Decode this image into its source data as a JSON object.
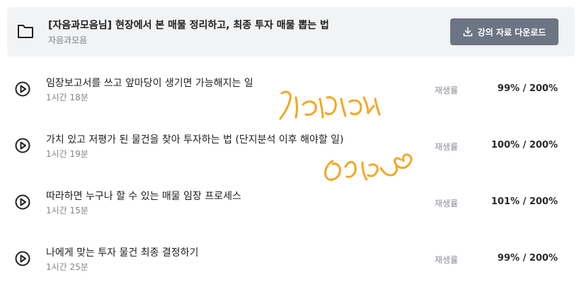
{
  "header": {
    "title": "[자음과모음님] 현장에서 본 매물 정리하고, 최종 투자 매물 뽑는 법",
    "subtitle": "자음과모음",
    "download_label": "강의 자료 다운로드",
    "folder_icon": "folder-icon",
    "download_icon": "download-icon"
  },
  "lessons": [
    {
      "title": "임장보고서를 쓰고 앞마당이 생기면 가능해지는 일",
      "duration": "1시간 18분",
      "rate_label": "재생률",
      "rate_value": "99% / 200%"
    },
    {
      "title": "가치 있고 저평가 된 물건을 찾아 투자하는 법 (단지분석 이후 해야할 일)",
      "duration": "1시간 19분",
      "rate_label": "재생률",
      "rate_value": "100% / 200%"
    },
    {
      "title": "따라하면 누구나 할 수 있는 매물 임장 프로세스",
      "duration": "1시간 15분",
      "rate_label": "재생률",
      "rate_value": "101% / 200%"
    },
    {
      "title": "나에게 맞는 투자 물건 최종 결정하기",
      "duration": "1시간 25분",
      "rate_label": "재생률",
      "rate_value": "99% / 200%"
    }
  ],
  "colors": {
    "accent_button": "#6b7583",
    "handwriting": "#f5a623"
  }
}
